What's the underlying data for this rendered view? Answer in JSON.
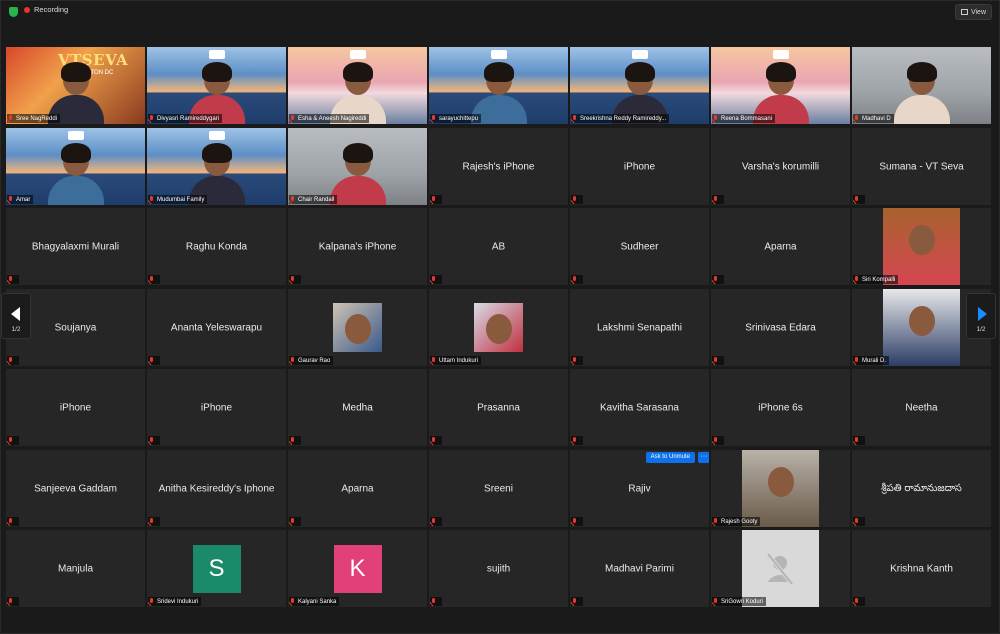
{
  "topbar": {
    "recording_label": "Recording",
    "view_label": "View"
  },
  "pagination": {
    "prev_label": "1/2",
    "next_label": "1/2"
  },
  "unmute": {
    "ask_label": "Ask to Unmute",
    "more_label": "···"
  },
  "colors": {
    "active_speaker": "#e2d86a",
    "recording": "#e5362c",
    "accent": "#0e71eb",
    "muted_mic": "#e23b2e"
  },
  "participants": [
    {
      "name": "Sree NagReddi",
      "video": "vtseva",
      "banner": "VTSEVA",
      "sub": "WASHINGTON DC"
    },
    {
      "name": "Divyasri Ramireddygari",
      "video": "lake"
    },
    {
      "name": "Esha & Aneesh Nagireddi",
      "video": "blossom"
    },
    {
      "name": "sarayuchittepu",
      "video": "lake"
    },
    {
      "name": "Sreekrishna Reddy Ramireddy...",
      "video": "lake"
    },
    {
      "name": "Reena Bommasani",
      "video": "blossom"
    },
    {
      "name": "Madhavi D",
      "video": "room"
    },
    {
      "name": "Amar",
      "video": "lake"
    },
    {
      "name": "Mudumbai Family",
      "video": "lake"
    },
    {
      "name": "Chair Randall",
      "video": "room",
      "active": true
    },
    {
      "name": "Rajesh's iPhone"
    },
    {
      "name": "iPhone"
    },
    {
      "name": "Varsha's korumilli"
    },
    {
      "name": "Sumana - VT Seva"
    },
    {
      "name": "Bhagyalaxmi Murali"
    },
    {
      "name": "Raghu Konda"
    },
    {
      "name": "Kalpana's iPhone"
    },
    {
      "name": "AB"
    },
    {
      "name": "Sudheer"
    },
    {
      "name": "Aparna"
    },
    {
      "name": "Siri Kompalli",
      "photo": "siri"
    },
    {
      "name": "Soujanya"
    },
    {
      "name": "Ananta Yeleswarapu"
    },
    {
      "name": "Gaurav Rao",
      "photo": "gaurav"
    },
    {
      "name": "Uttam Indukuri",
      "photo": "uttam"
    },
    {
      "name": "Lakshmi Senapathi"
    },
    {
      "name": "Srinivasa Edara"
    },
    {
      "name": "Murali D.",
      "photo": "murali"
    },
    {
      "name": "iPhone"
    },
    {
      "name": "iPhone"
    },
    {
      "name": "Medha"
    },
    {
      "name": "Prasanna"
    },
    {
      "name": "Kavitha Sarasana"
    },
    {
      "name": "iPhone 6s"
    },
    {
      "name": "Neetha"
    },
    {
      "name": "Sanjeeva Gaddam"
    },
    {
      "name": "Anitha Kesireddy's Iphone"
    },
    {
      "name": "Aparna"
    },
    {
      "name": "Sreeni"
    },
    {
      "name": "Rajiv",
      "hover": true
    },
    {
      "name": "Rajesh Gooty",
      "photo": "rajesh"
    },
    {
      "name": "శ్రీపతి రామానుజదాస"
    },
    {
      "name": "Manjula"
    },
    {
      "name": "Sridevi Indukuri",
      "letter": "S",
      "letter_color": "#1b8a6b"
    },
    {
      "name": "Kalyani Sanka",
      "letter": "K",
      "letter_color": "#e2407a"
    },
    {
      "name": "sujith"
    },
    {
      "name": "Madhavi Parimi"
    },
    {
      "name": "SriGowri Koduri",
      "photo": "none"
    },
    {
      "name": "Krishna Kanth"
    }
  ]
}
